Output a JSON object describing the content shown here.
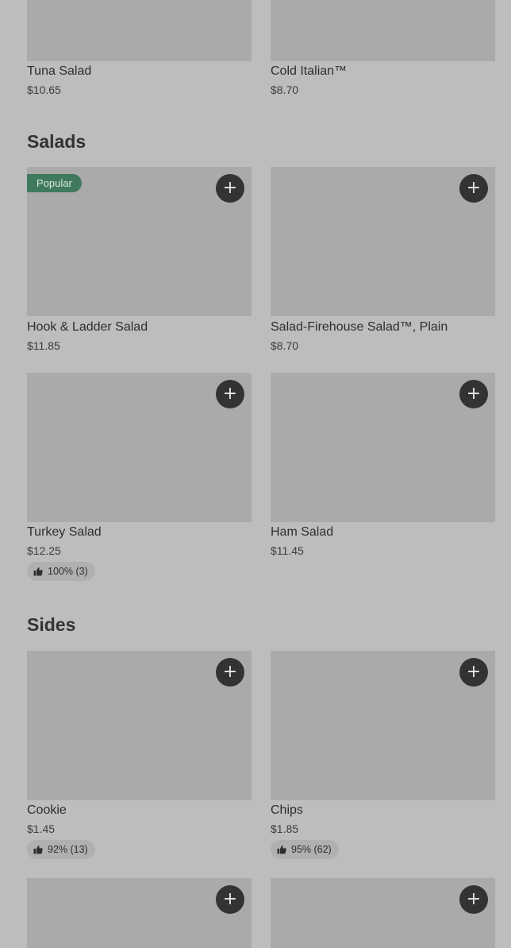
{
  "items_top": [
    {
      "name": "Tuna Salad",
      "price": "$10.65"
    },
    {
      "name": "Cold Italian™",
      "price": "$8.70"
    }
  ],
  "sections": [
    {
      "title": "Salads",
      "items": [
        {
          "name": "Hook & Ladder Salad",
          "price": "$11.85",
          "badge": "Popular"
        },
        {
          "name": "Salad-Firehouse Salad™, Plain",
          "price": "$8.70"
        },
        {
          "name": "Turkey Salad",
          "price": "$12.25",
          "rating": "100% (3)"
        },
        {
          "name": "Ham Salad",
          "price": "$11.45"
        }
      ]
    },
    {
      "title": "Sides",
      "items": [
        {
          "name": "Cookie",
          "price": "$1.45",
          "rating": "92% (13)"
        },
        {
          "name": "Chips",
          "price": "$1.85",
          "rating": "95% (62)"
        }
      ]
    }
  ],
  "add_button_icon": "plus-icon",
  "rating_icon": "thumbs-up-icon",
  "colors": {
    "background": "#bdbdbd",
    "image_placeholder": "#aaaaaa",
    "add_button": "#333333",
    "popular_badge": "#3f7a5c"
  }
}
